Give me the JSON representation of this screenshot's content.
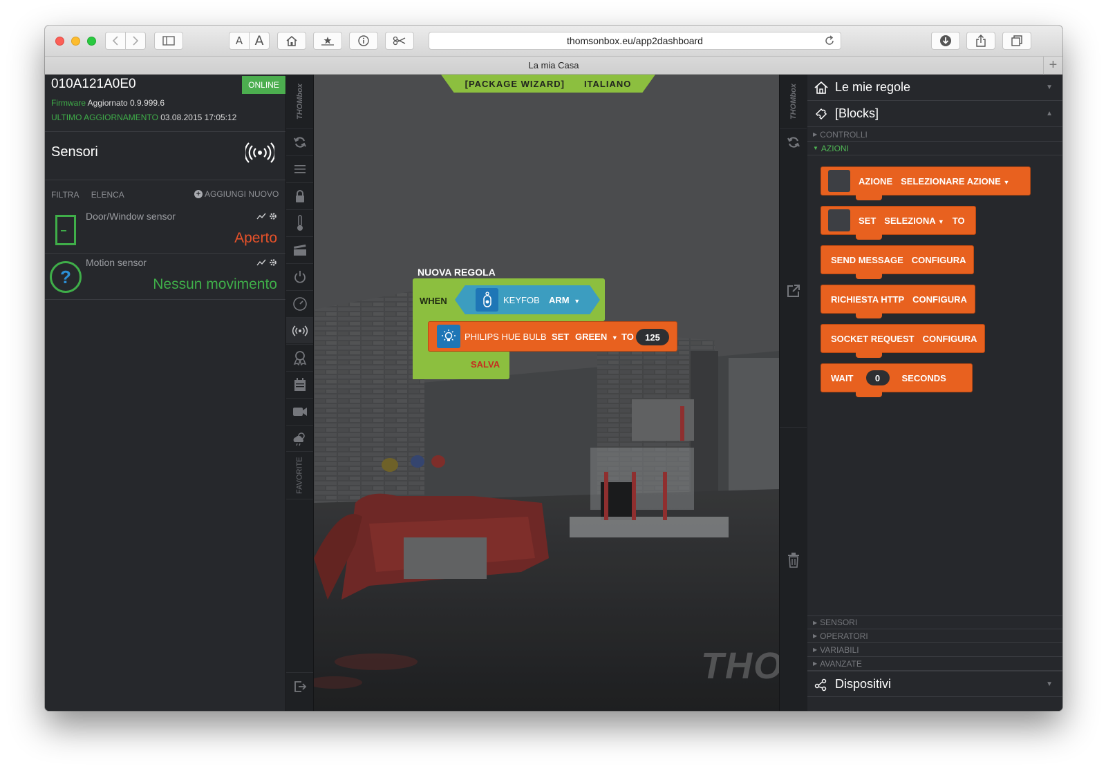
{
  "browser": {
    "url": "thomsonbox.eu/app2dashboard",
    "tab_title": "La mia Casa",
    "new_tab_label": "+",
    "font_small": "A",
    "font_large": "A"
  },
  "device": {
    "id": "010A121A0E0",
    "status": "ONLINE",
    "firmware_label": "Firmware",
    "firmware_value": "Aggiornato 0.9.999.6",
    "update_label": "ULTIMO AGGIORNAMENTO",
    "update_value": "03.08.2015 17:05:12"
  },
  "sensors_panel": {
    "title": "Sensori",
    "filter": "FILTRA",
    "list": "ELENCA",
    "add_new": "AGGIUNGI NUOVO",
    "items": [
      {
        "name": "Door/Window sensor",
        "status": "Aperto",
        "status_color": "#e8522a"
      },
      {
        "name": "Motion sensor",
        "status": "Nessun movimento",
        "status_color": "#3fae49"
      }
    ]
  },
  "brand": "THOMbox",
  "favorites_label": "FAVORITE",
  "canvas": {
    "package_wizard": "[PACKAGE WIZARD]",
    "language": "ITALIANO",
    "watermark": "THO",
    "rule": {
      "title": "NUOVA REGOLA",
      "when": "WHEN",
      "trigger_device": "KEYFOB",
      "trigger_value": "ARM",
      "action_device": "PHILIPS HUE BULB",
      "action_set": "SET",
      "action_channel": "GREEN",
      "action_to": "TO",
      "action_value": "125",
      "save": "SALVA"
    }
  },
  "rules_panel": {
    "my_rules": "Le mie regole",
    "blocks": "[Blocks]",
    "categories_top": [
      "CONTROLLI",
      "AZIONI"
    ],
    "blocks_list": {
      "azione": {
        "label": "AZIONE",
        "value": "SELEZIONARE AZIONE"
      },
      "set": {
        "label": "SET",
        "value": "SELEZIONA",
        "to": "TO"
      },
      "send": {
        "label": "SEND MESSAGE",
        "value": "CONFIGURA"
      },
      "http": {
        "label": "RICHIESTA HTTP",
        "value": "CONFIGURA"
      },
      "socket": {
        "label": "SOCKET REQUEST",
        "value": "CONFIGURA"
      },
      "wait": {
        "label": "WAIT",
        "value": "0",
        "unit": "SECONDS"
      }
    },
    "categories_bottom": [
      "SENSORI",
      "OPERATORI",
      "VARIABILI",
      "AVANZATE"
    ],
    "devices": "Dispositivi"
  },
  "colors": {
    "accent_green": "#8cbf3f",
    "block_orange": "#e8611f",
    "online_green": "#4cae4f",
    "keyfob_blue": "#3c9dc0"
  }
}
